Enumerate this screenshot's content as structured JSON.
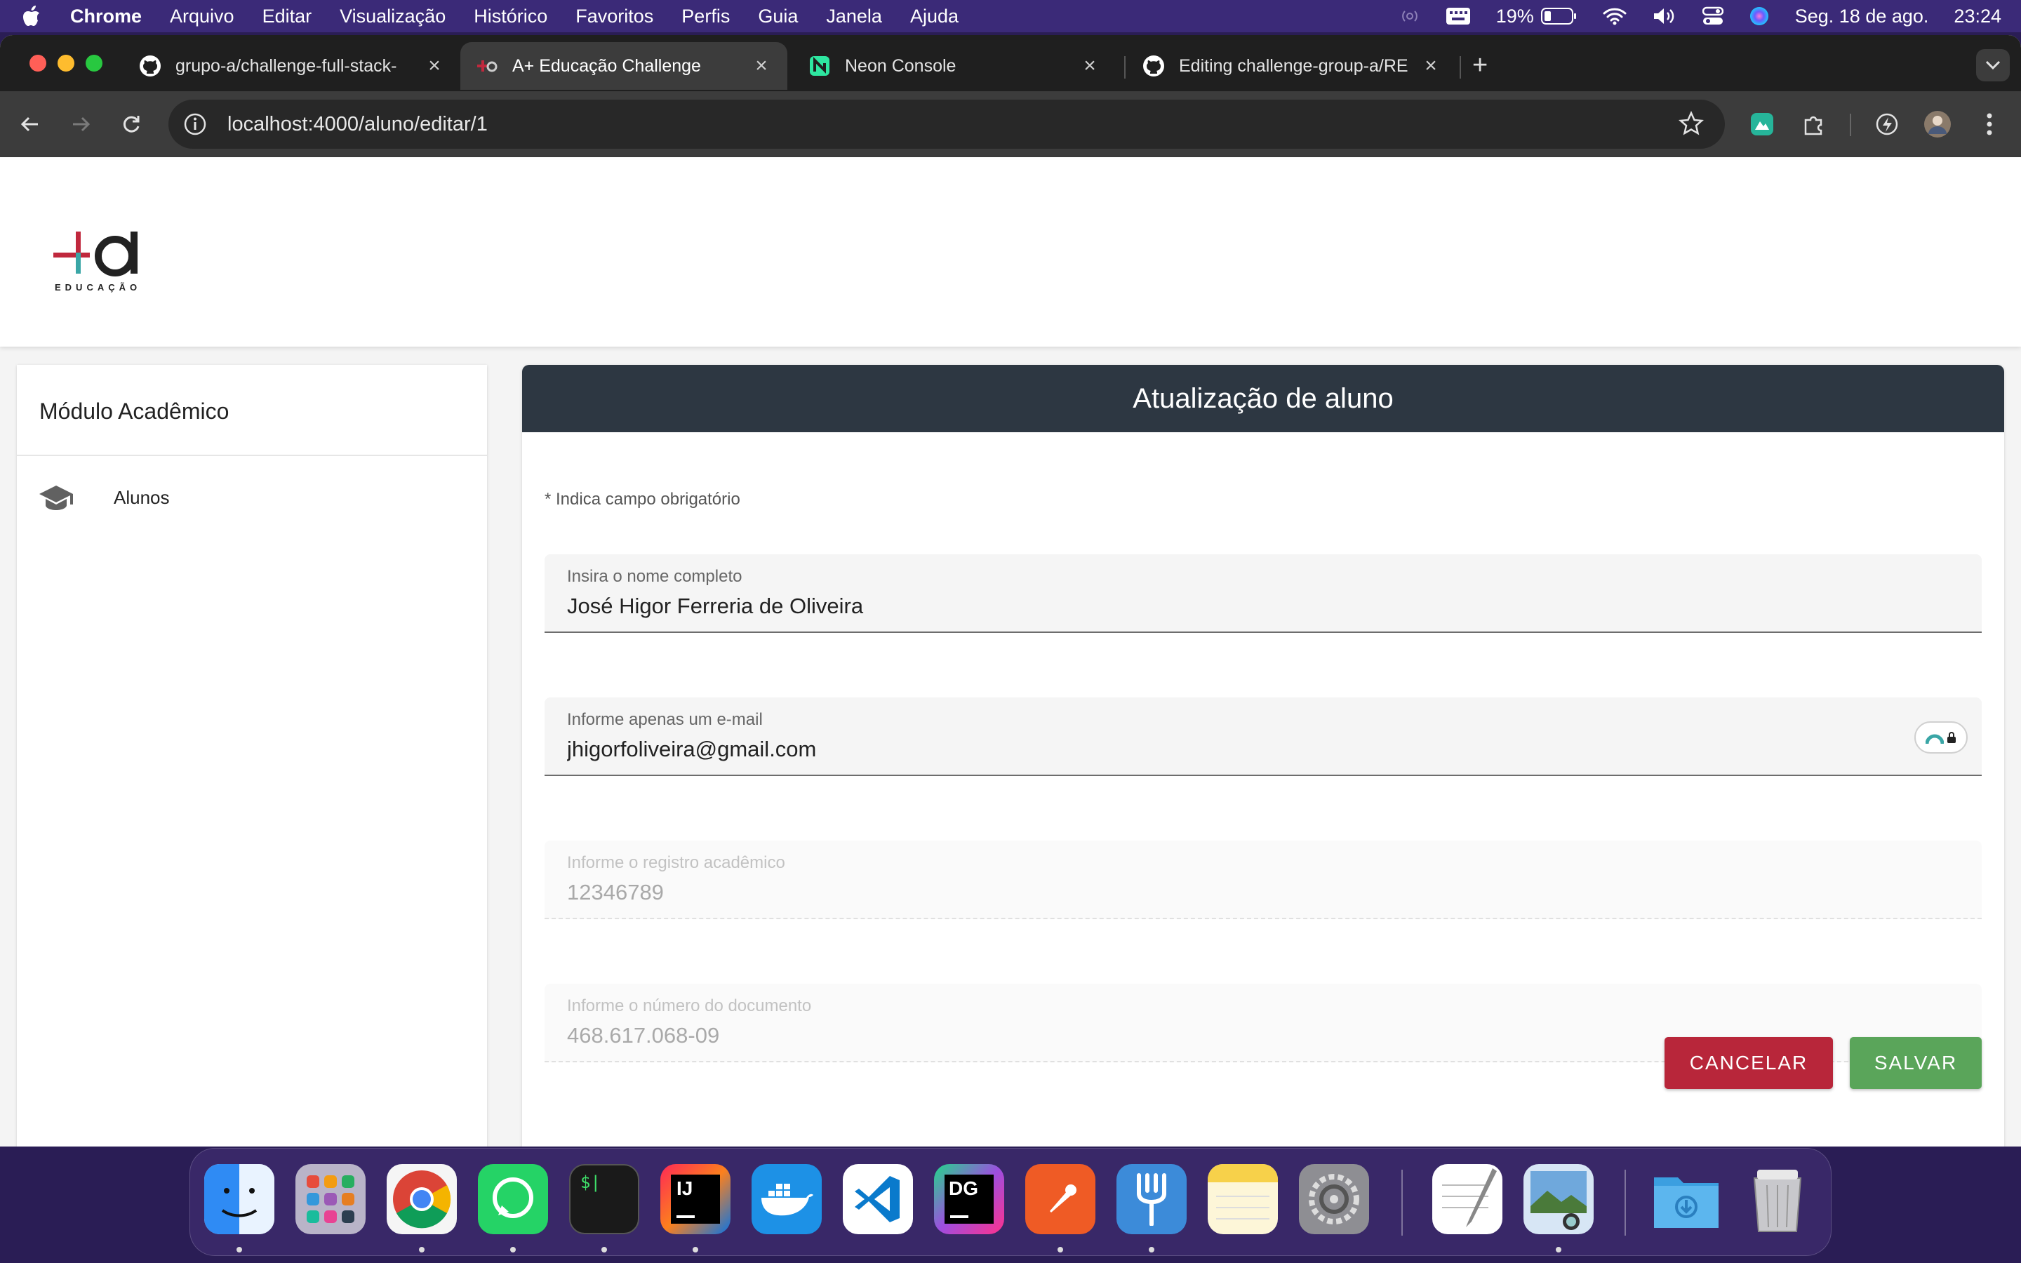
{
  "menubar": {
    "app_name": "Chrome",
    "items": [
      "Arquivo",
      "Editar",
      "Visualização",
      "Histórico",
      "Favoritos",
      "Perfis",
      "Guia",
      "Janela",
      "Ajuda"
    ],
    "battery": "19%",
    "date": "Seg. 18 de ago.",
    "time": "23:24"
  },
  "tabs": [
    {
      "title": "grupo-a/challenge-full-stack-",
      "icon": "github-icon"
    },
    {
      "title": "A+ Educação Challenge",
      "icon": "aplus-icon"
    },
    {
      "title": "Neon Console",
      "icon": "neon-icon"
    },
    {
      "title": "Editing challenge-group-a/RE",
      "icon": "github-icon"
    }
  ],
  "address_bar": {
    "url": "localhost:4000/aluno/editar/1"
  },
  "logo": {
    "caption": "EDUCAÇÃO"
  },
  "sidebar": {
    "title": "Módulo Acadêmico",
    "items": [
      {
        "label": "Alunos",
        "icon": "graduation-cap-icon"
      }
    ]
  },
  "form": {
    "title": "Atualização de aluno",
    "required_note": "* Indica campo obrigatório",
    "fields": {
      "name": {
        "label": "Insira o nome completo",
        "value": "José Higor Ferreria de Oliveira"
      },
      "email": {
        "label": "Informe apenas um e-mail",
        "value": "jhigorfoliveira@gmail.com"
      },
      "ra": {
        "label": "Informe o registro acadêmico",
        "value": "12346789"
      },
      "cpf": {
        "label": "Informe o número do documento",
        "value": "468.617.068-09"
      }
    },
    "cancel_label": "CANCELAR",
    "save_label": "SALVAR"
  },
  "colors": {
    "menubar": "#3b2a78",
    "card_header": "#2d3742",
    "cancel": "#b8263a",
    "save": "#5aa55a",
    "logo_red": "#c0283d",
    "logo_teal": "#3aa6a6"
  },
  "dock": {
    "apps": [
      "finder-icon",
      "launchpad-icon",
      "chrome-icon",
      "whatsapp-icon",
      "terminal-icon",
      "intellij-icon",
      "docker-icon",
      "vscode-icon",
      "datagrip-icon",
      "postman-icon",
      "fork-icon",
      "notes-icon",
      "system-settings-icon",
      "textedit-icon",
      "preview-icon",
      "downloads-folder-icon",
      "trash-icon"
    ],
    "terminal_label": "$|",
    "intellij_label": "IJ",
    "datagrip_label": "DG"
  }
}
